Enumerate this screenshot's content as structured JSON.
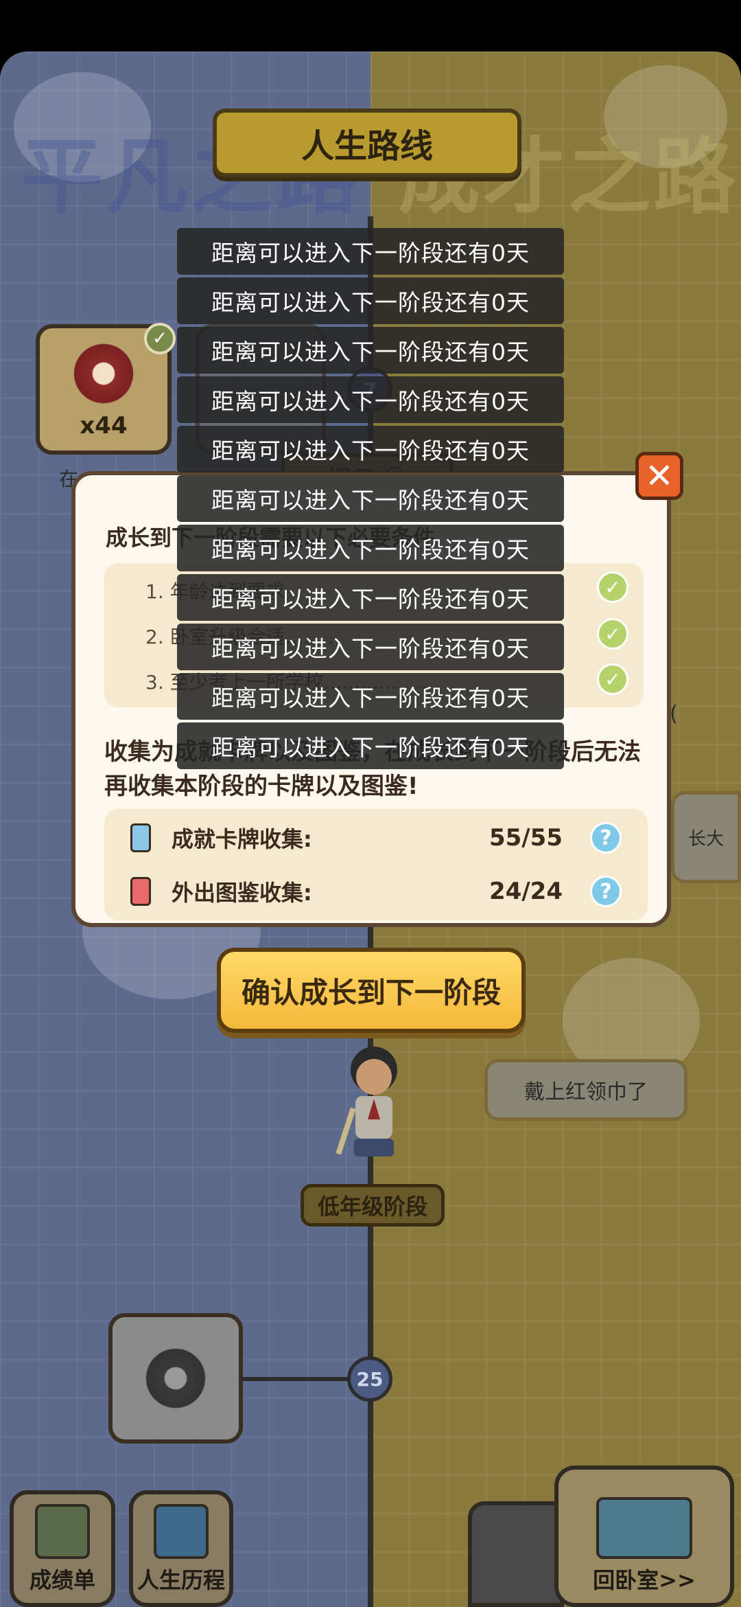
{
  "header": {
    "route_title": "人生路线",
    "left_path": "平凡之路",
    "right_path": "成才之路"
  },
  "map": {
    "top_card_count": "x44",
    "left_caption": "在",
    "hint_label": "提示",
    "top_node": "7",
    "bottom_node": "25",
    "stage_label": "低年级阶段",
    "speech_bubble": "戴上红领巾了",
    "side_bubble": "长大",
    "side_text": "("
  },
  "dialog": {
    "heading": "成长到下一阶段需要以下必要条件",
    "conditions": [
      "1. 年龄达到要求",
      "2. 卧室升级合适........",
      "3. 至少考上一所学校..................."
    ],
    "warning": "收集为成就卡牌以及图鉴，在成长到下一阶段后无法再收集本阶段的卡牌以及图鉴!",
    "collections": [
      {
        "label": "成就卡牌收集:",
        "value": "55/55",
        "color": "#8ec8e8"
      },
      {
        "label": "外出图鉴收集:",
        "value": "24/24",
        "color": "#e86a6a"
      }
    ],
    "help_glyph": "?",
    "close_glyph": "✕",
    "check_glyph": "✓"
  },
  "confirm": {
    "label": "确认成长到下一阶段"
  },
  "bottom_nav": {
    "report": "成绩单",
    "history": "人生历程",
    "bedroom": "回卧室>>"
  },
  "toasts": [
    "距离可以进入下一阶段还有0天",
    "距离可以进入下一阶段还有0天",
    "距离可以进入下一阶段还有0天",
    "距离可以进入下一阶段还有0天",
    "距离可以进入下一阶段还有0天",
    "距离可以进入下一阶段还有0天",
    "距离可以进入下一阶段还有0天",
    "距离可以进入下一阶段还有0天",
    "距离可以进入下一阶段还有0天",
    "距离可以进入下一阶段还有0天",
    "距离可以进入下一阶段还有0天"
  ]
}
